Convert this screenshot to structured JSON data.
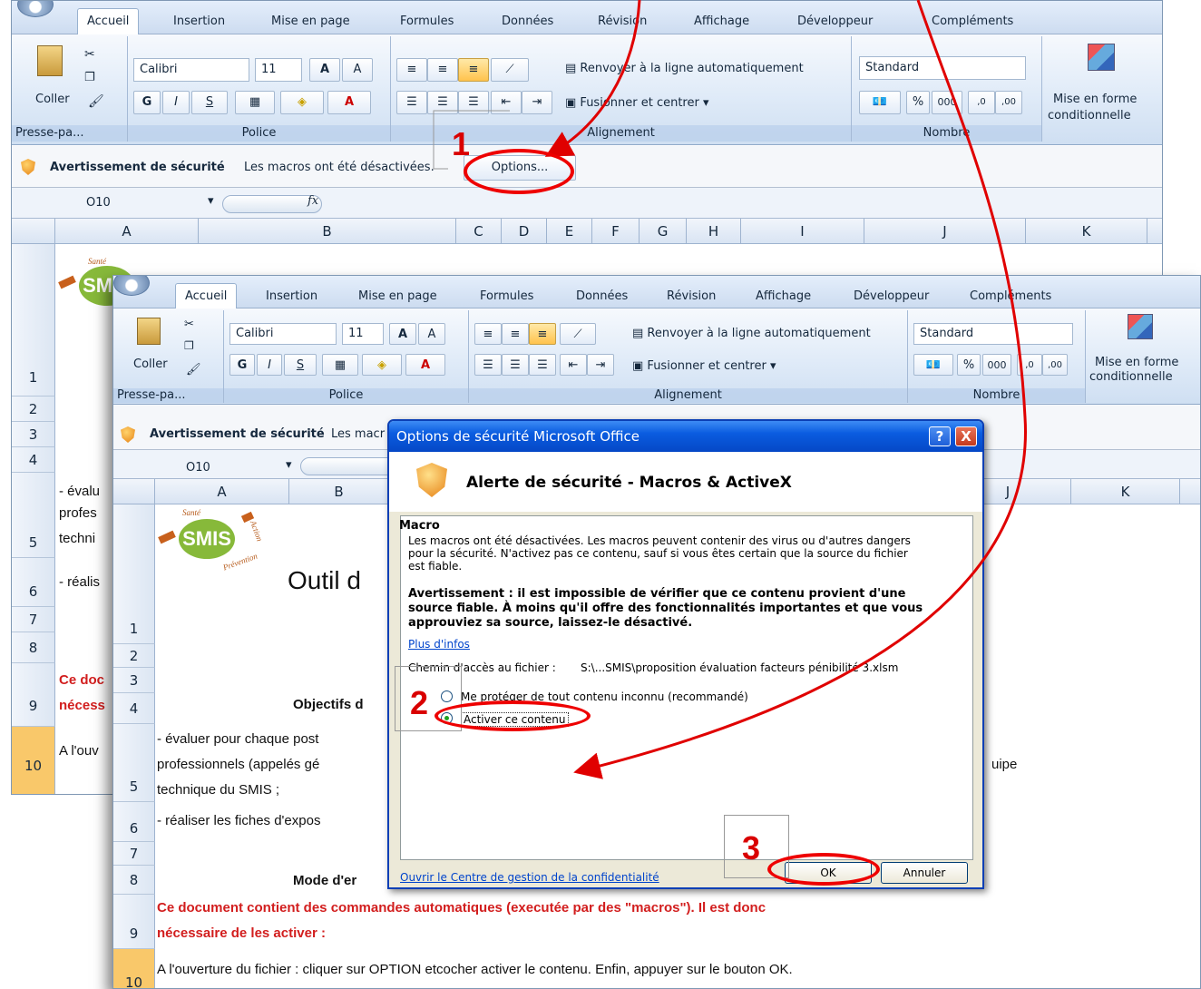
{
  "ribbon_tabs": [
    "Accueil",
    "Insertion",
    "Mise en page",
    "Formules",
    "Données",
    "Révision",
    "Affichage",
    "Développeur",
    "Compléments"
  ],
  "clipboard": {
    "paste_label": "Coller",
    "group": "Presse-pa..."
  },
  "font": {
    "name": "Calibri",
    "size": "11",
    "grow": "A",
    "shrink": "A",
    "bold": "G",
    "italic": "I",
    "underline": "S",
    "color_letter": "A",
    "group": "Police"
  },
  "alignment": {
    "wrap": "Renvoyer à la ligne automatiquement",
    "merge": "Fusionner et centrer",
    "group": "Alignement"
  },
  "number": {
    "format": "Standard",
    "percent": "%",
    "thousands": "000",
    "dec_up": ",0 ,00",
    "dec_down": ",00 ,0",
    "group": "Nombre"
  },
  "styles": {
    "cond_format_1": "Mise en forme",
    "cond_format_2": "conditionnelle"
  },
  "security_bar": {
    "title": "Avertissement de sécurité",
    "text": "Les macros ont été désactivées.",
    "text_short": "Les macr",
    "options_button": "Options..."
  },
  "formula_bar": {
    "cell_ref": "O10",
    "fx": "fx"
  },
  "columns": [
    "A",
    "B",
    "C",
    "D",
    "E",
    "F",
    "G",
    "H",
    "I",
    "J",
    "K"
  ],
  "rows_back": [
    "1",
    "2",
    "3",
    "4",
    "5",
    "6",
    "7",
    "8",
    "9",
    "10"
  ],
  "rows_front": [
    "1",
    "2",
    "3",
    "4",
    "5",
    "6",
    "7",
    "8",
    "9",
    "10"
  ],
  "logo": {
    "sante": "Santé",
    "action": "Action",
    "smis": "SMIS",
    "prevention": "Prévention"
  },
  "sheet": {
    "title": "Outil d",
    "objectifs": "Objectifs d",
    "bullet1_a": "- évaluer pour chaque post",
    "bullet1_b": "professionnels (appelés gé",
    "bullet1_c": "technique du SMIS ;",
    "bullet1_end": "uipe",
    "bullet2": "- réaliser les fiches d'expos",
    "mode": "Mode d'er",
    "warn_1": "Ce document contient des commandes automatiques (executée par des \"macros\"). Il est donc",
    "warn_2": "nécessaire de les activer :",
    "instruction": "A l'ouverture du fichier : cliquer sur OPTION etcocher activer le contenu. Enfin, appuyer sur le bouton OK."
  },
  "sheet_back": {
    "b1": "- évalu",
    "b2": "profes",
    "b3": "techni",
    "b4": "- réalis",
    "w1": "Ce doc",
    "w2": "nécess",
    "a1": "A l'ouv"
  },
  "dialog": {
    "title": "Options de sécurité Microsoft Office",
    "help": "?",
    "close": "X",
    "heading": "Alerte de sécurité - Macros & ActiveX",
    "section": "Macro",
    "p1": "Les macros ont été désactivées. Les macros peuvent contenir des virus ou d'autres dangers pour la sécurité. N'activez pas ce contenu, sauf si vous êtes certain que la source du fichier est fiable.",
    "warning": "Avertissement : il est impossible de vérifier que ce contenu provient d'une source fiable. À moins qu'il offre des fonctionnalités importantes et que vous approuviez sa source, laissez-le désactivé.",
    "more_link": "Plus d'infos",
    "path_label": "Chemin d'accès au fichier :",
    "path_value": "S:\\...SMIS\\proposition évaluation facteurs pénibilité 3.xlsm",
    "option_protect": "Me protéger de tout contenu inconnu (recommandé)",
    "option_enable": "Activer ce contenu",
    "trust_link": "Ouvrir le Centre de gestion de la confidentialité",
    "ok": "OK",
    "cancel": "Annuler"
  },
  "annotations": {
    "step1": "1",
    "step2": "2",
    "step3": "3"
  },
  "colors": {
    "annotation_red": "#e00000",
    "ribbon_blue": "#dbe7f6",
    "xp_title": "#0a5ce0",
    "warn_red": "#d21e1e"
  }
}
